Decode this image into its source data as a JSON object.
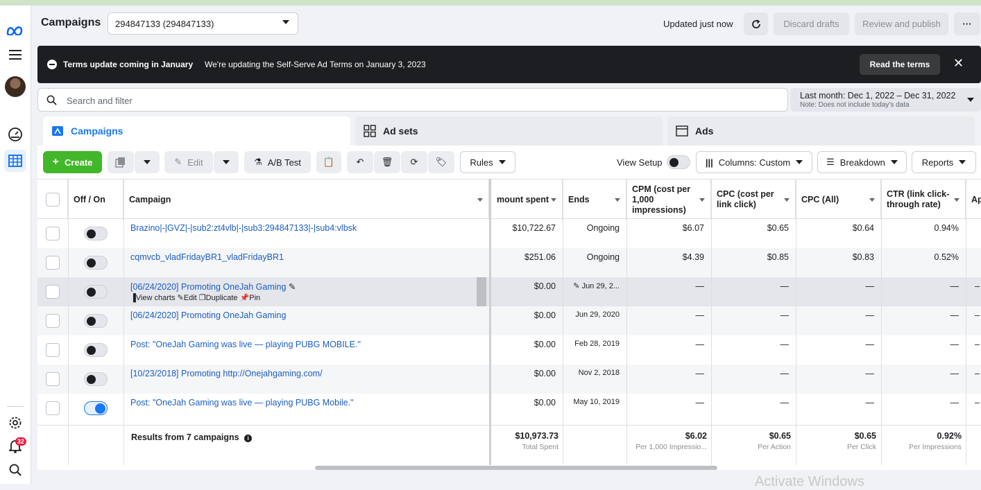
{
  "header": {
    "title": "Campaigns",
    "account_selected": "294847133 (294847133)",
    "updated_text": "Updated just now",
    "discard_label": "Discard drafts",
    "review_label": "Review and publish",
    "more_label": "···"
  },
  "sidebar": {
    "notification_count": "32"
  },
  "banner": {
    "title": "Terms update coming in January",
    "text": "We're updating the Self-Serve Ad Terms on January 3, 2023",
    "button": "Read the terms"
  },
  "search": {
    "placeholder": "Search and filter"
  },
  "date_range": {
    "label": "Last month: Dec 1, 2022 – Dec 31, 2022",
    "note": "Note: Does not include today's data"
  },
  "tabs": [
    {
      "label": "Campaigns"
    },
    {
      "label": "Ad sets"
    },
    {
      "label": "Ads"
    }
  ],
  "toolbar": {
    "create": "Create",
    "edit": "Edit",
    "ab_test": "A/B Test",
    "rules": "Rules",
    "view_setup": "View Setup",
    "columns": "Columns: Custom",
    "breakdown": "Breakdown",
    "reports": "Reports"
  },
  "columns": {
    "off_on": "Off / On",
    "campaign": "Campaign",
    "amount_spent": "mount spent",
    "ends": "Ends",
    "cpm": "CPM (cost per 1,000 impressions)",
    "cpc_link": "CPC (cost per link click)",
    "cpc_all": "CPC (All)",
    "ctr": "CTR (link click-through rate)",
    "next": "Ap"
  },
  "row_actions": {
    "view_charts": "View charts",
    "edit": "Edit",
    "duplicate": "Duplicate",
    "pin": "Pin"
  },
  "rows": [
    {
      "name": "Brazino|-|GVZ|-|sub2:zt4vlb|-|sub3:294847133|-|sub4:vlbsk",
      "spent": "$10,722.67",
      "ends": "Ongoing",
      "cpm": "$6.07",
      "cpc_link": "$0.65",
      "cpc_all": "$0.64",
      "ctr": "0.94%",
      "on": false
    },
    {
      "name": "cqmvcb_vladFridayBR1_vladFridayBR1",
      "spent": "$251.06",
      "ends": "Ongoing",
      "cpm": "$4.39",
      "cpc_link": "$0.85",
      "cpc_all": "$0.83",
      "ctr": "0.52%",
      "on": false
    },
    {
      "name": "[06/24/2020] Promoting OneJah Gaming",
      "spent": "$0.00",
      "ends": "Jun 29, 2...",
      "cpm": "—",
      "cpc_link": "—",
      "cpc_all": "—",
      "ctr": "—",
      "on": false
    },
    {
      "name": "[06/24/2020] Promoting OneJah Gaming",
      "spent": "$0.00",
      "ends": "Jun 29, 2020",
      "cpm": "—",
      "cpc_link": "—",
      "cpc_all": "—",
      "ctr": "—",
      "on": false
    },
    {
      "name": "Post: \"OneJah Gaming was live — playing PUBG MOBILE.\"",
      "spent": "$0.00",
      "ends": "Feb 28, 2019",
      "cpm": "—",
      "cpc_link": "—",
      "cpc_all": "—",
      "ctr": "—",
      "on": false
    },
    {
      "name": "[10/23/2018] Promoting http://Onejahgaming.com/",
      "spent": "$0.00",
      "ends": "Nov 2, 2018",
      "cpm": "—",
      "cpc_link": "—",
      "cpc_all": "—",
      "ctr": "—",
      "on": false
    },
    {
      "name": "Post: \"OneJah Gaming was live — playing PUBG Mobile.\"",
      "spent": "$0.00",
      "ends": "May 10, 2019",
      "cpm": "—",
      "cpc_link": "—",
      "cpc_all": "—",
      "ctr": "—",
      "on": true
    }
  ],
  "totals": {
    "label": "Results from 7 campaigns",
    "spent": "$10,973.73",
    "spent_sub": "Total Spent",
    "cpm": "$6.02",
    "cpm_sub": "Per 1,000 Impressio...",
    "cpc_link": "$0.65",
    "cpc_link_sub": "Per Action",
    "cpc_all": "$0.65",
    "cpc_all_sub": "Per Click",
    "ctr": "0.92%",
    "ctr_sub": "Per Impressions"
  },
  "watermark": "Activate Windows",
  "colors": {
    "accent": "#1877f2",
    "create_green": "#42b72a",
    "link": "#1a5ec4",
    "banner_bg": "#1c1e21"
  }
}
